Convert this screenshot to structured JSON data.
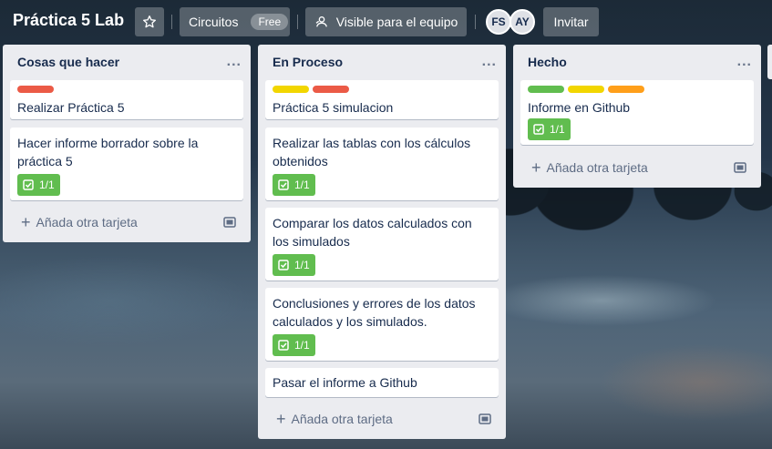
{
  "board": {
    "title": "Práctica 5 Lab",
    "workspace_label": "Circuitos",
    "workspace_badge": "Free",
    "visibility_label": "Visible para el equipo",
    "invite_label": "Invitar",
    "members": [
      "FS",
      "AY"
    ]
  },
  "icons": {
    "star": "star-icon",
    "visibility": "team-icon",
    "menu": "more-icon",
    "plus": "plus-icon",
    "template": "card-template-icon",
    "checklist": "checklist-icon"
  },
  "colors": {
    "label_red": "#eb5a46",
    "label_yellow": "#f2d600",
    "label_green": "#61bd4f",
    "label_orange": "#ff9f1a",
    "badge_green": "#61bd4f"
  },
  "lists": [
    {
      "title": "Cosas que hacer",
      "menu": "...",
      "add_label": "Añada otra tarjeta",
      "cards": [
        {
          "title": "Realizar Práctica 5",
          "labels": [
            "red"
          ]
        },
        {
          "title": "Hacer informe borrador sobre la práctica 5",
          "checklist": "1/1"
        }
      ]
    },
    {
      "title": "En Proceso",
      "menu": "...",
      "add_label": "Añada otra tarjeta",
      "cards": [
        {
          "title": "Práctica 5 simulacion",
          "labels": [
            "yellow",
            "red"
          ]
        },
        {
          "title": "Realizar las tablas con los cálculos obtenidos",
          "checklist": "1/1"
        },
        {
          "title": "Comparar los datos calculados con los simulados",
          "checklist": "1/1"
        },
        {
          "title": "Conclusiones y errores de los datos calculados y los simulados.",
          "checklist": "1/1"
        },
        {
          "title": "Pasar el informe a Github"
        }
      ]
    },
    {
      "title": "Hecho",
      "menu": "...",
      "add_label": "Añada otra tarjeta",
      "cards": [
        {
          "title": "Informe en Github",
          "labels": [
            "green",
            "yellow",
            "orange"
          ],
          "checklist": "1/1"
        }
      ]
    }
  ]
}
